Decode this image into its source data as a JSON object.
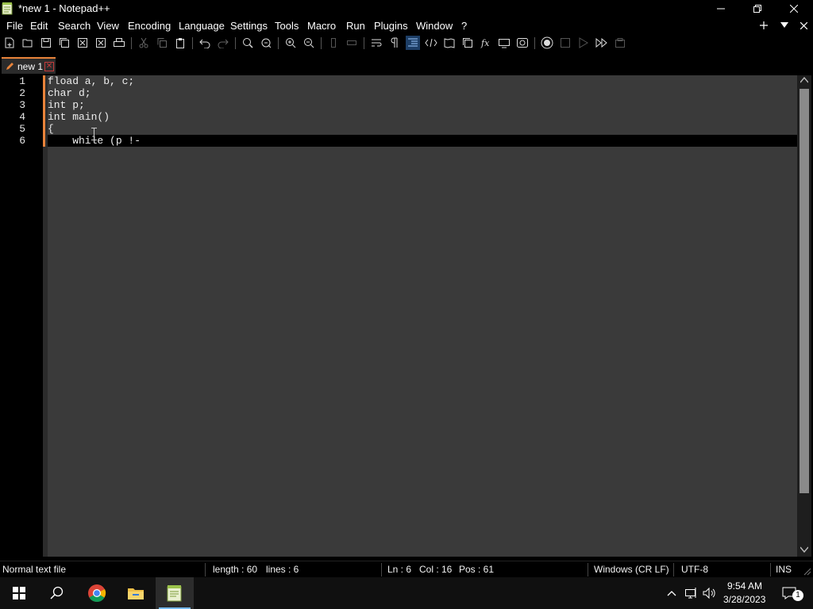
{
  "window": {
    "title": "*new 1 - Notepad++"
  },
  "menu": [
    "File",
    "Edit",
    "Search",
    "View",
    "Encoding",
    "Language",
    "Settings",
    "Tools",
    "Macro",
    "Run",
    "Plugins",
    "Window",
    "?"
  ],
  "menu_right": {
    "add_icon": "plus-icon",
    "dropdown_icon": "triangle-down-icon",
    "close_icon": "close-icon"
  },
  "toolbar_icons": [
    "new-file-icon",
    "open-file-icon",
    "save-icon",
    "save-all-icon",
    "close-icon",
    "close-all-icon",
    "print-icon",
    "cut-icon",
    "copy-icon",
    "paste-icon",
    "undo-icon",
    "redo-icon",
    "find-icon",
    "replace-icon",
    "zoom-in-icon",
    "zoom-out-icon",
    "sync-vertical-icon",
    "sync-horizontal-icon",
    "word-wrap-icon",
    "show-all-characters-icon",
    "indent-guide-icon",
    "xml-tag-icon",
    "document-map-icon",
    "document-list-icon",
    "function-list-icon",
    "folder-as-workspace-icon",
    "monitoring-icon",
    "record-macro-icon",
    "stop-recording-icon",
    "playback-icon",
    "run-multiple-icon",
    "save-macro-icon"
  ],
  "tabs": [
    {
      "label": "new 1",
      "modified": true
    }
  ],
  "editor": {
    "line_numbers": [
      "1",
      "2",
      "3",
      "4",
      "5",
      "6"
    ],
    "lines": [
      "fload a, b, c;",
      "char d;",
      "int p;",
      "int main()",
      "{",
      "    while (p !-"
    ],
    "current_line": 6
  },
  "status": {
    "filetype": "Normal text file",
    "length": "length : 60",
    "lines": "lines : 6",
    "ln": "Ln : 6",
    "col": "Col : 16",
    "pos": "Pos : 61",
    "eol": "Windows (CR LF)",
    "encoding": "UTF-8",
    "mode": "INS"
  },
  "taskbar": {
    "apps": [
      "windows-start-icon",
      "search-icon",
      "chrome-icon",
      "file-explorer-icon",
      "notepad-plus-plus-icon"
    ],
    "tray_icons": [
      "show-hidden-icons-chevron",
      "network-icon",
      "volume-icon"
    ],
    "time": "9:54 AM",
    "date": "3/28/2023",
    "notification_count": "1"
  },
  "colors": {
    "accent_orange": "#e8833a",
    "editor_bg": "#3a3a3a",
    "current_line_bg": "#000000",
    "taskbar_accent": "#76b9ed"
  }
}
